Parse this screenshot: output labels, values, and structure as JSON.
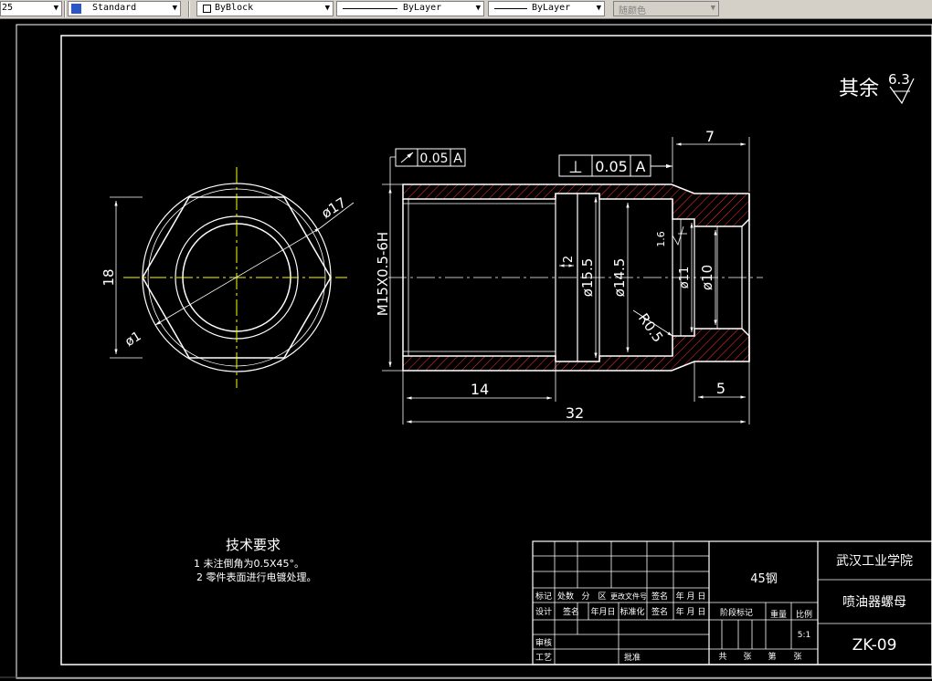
{
  "toolbar": {
    "scale_value": "25",
    "text_style": "Standard",
    "layer_color": "ByBlock",
    "linetype": "ByLayer",
    "lineweight": "ByLayer",
    "plot_style": "随颜色"
  },
  "drawing": {
    "roughness": {
      "label": "其余",
      "value": "6.3"
    },
    "dims": {
      "hex_height": "18",
      "dia_17": "ø17",
      "dia_1": "ø1",
      "thread": "M15X0.5-6H",
      "len_14": "14",
      "len_32": "32",
      "len_7": "7",
      "len_5": "5",
      "dia_15_5": "ø15.5",
      "dia_14_5": "ø14.5",
      "dia_11": "ø11",
      "dia_10": "ø10",
      "groove_2": "2",
      "r_0_5": "R0.5",
      "r_1_6": "1.6"
    },
    "tolerances": {
      "runout": {
        "value": "0.05",
        "datum": "A"
      },
      "perpendicular": {
        "symbol": "⊥",
        "value": "0.05",
        "datum": "A"
      },
      "datum_label": "A"
    },
    "tech_req": {
      "title": "技术要求",
      "line1": "1 未注倒角为0.5X45°。",
      "line2": "2  零件表面进行电镀处理。"
    },
    "title_block": {
      "material": "45钢",
      "school": "武汉工业学院",
      "part_name": "喷油器螺母",
      "drawing_no": "ZK-09",
      "scale": "5:1",
      "labels": {
        "mark": "标记",
        "count": "处数",
        "zone": "分　区",
        "doc_no": "更改文件号",
        "sign": "签名",
        "date": "年 月 日",
        "design": "设计",
        "sign2": "签名",
        "date2": "年月日",
        "std": "标准化",
        "sign3": "签名",
        "date3": "年 月 日",
        "stage": "阶段标记",
        "weight": "重量",
        "scale_lbl": "比例",
        "review": "审核",
        "process": "工艺",
        "approve": "批准",
        "total": "共",
        "sheets": "张",
        "sheet_no": "第",
        "sheets2": "张"
      }
    }
  }
}
